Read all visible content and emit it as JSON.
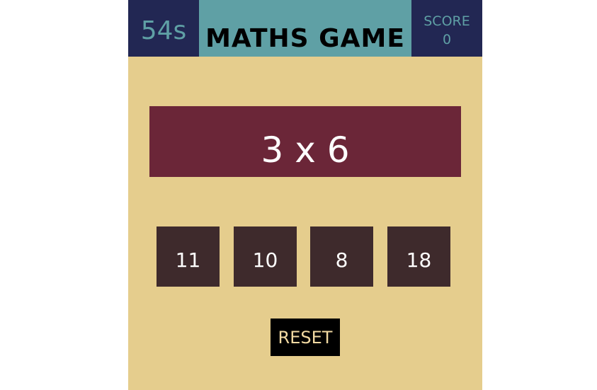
{
  "header": {
    "timer": "54s",
    "title": "MATHS GAME",
    "score_label": "SCORE",
    "score_value": "0"
  },
  "question": {
    "text": "3 x 6"
  },
  "answers": [
    {
      "label": "11"
    },
    {
      "label": "10"
    },
    {
      "label": "8"
    },
    {
      "label": "18"
    }
  ],
  "controls": {
    "reset_label": "RESET"
  },
  "colors": {
    "background": "#e5cd8d",
    "header_dark": "#222753",
    "header_teal": "#5fa0a5",
    "question_bg": "#6b2638",
    "answer_bg": "#3e2a2c",
    "reset_bg": "#000000",
    "reset_text": "#f1d9a2"
  }
}
